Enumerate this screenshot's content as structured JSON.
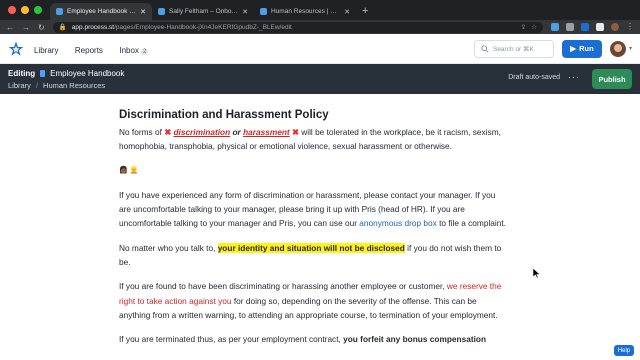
{
  "browser": {
    "tabs": [
      {
        "title": "Employee Handbook | Proces",
        "active": true
      },
      {
        "title": "Sally Feltham – Onboarding | P",
        "active": false
      },
      {
        "title": "Human Resources | Process St",
        "active": false
      }
    ],
    "url_host": "app.process.st",
    "url_path": "/pages/Employee-Handbook-jXn4JeKERfGpudbZ-_BLEw/edit"
  },
  "header": {
    "nav": {
      "library": "Library",
      "reports": "Reports",
      "inbox": "Inbox",
      "inbox_count": "2"
    },
    "search_placeholder": "Search or ⌘K",
    "run_label": "Run"
  },
  "editbar": {
    "editing_label": "Editing",
    "doc_title": "Employee Handbook",
    "breadcrumb": [
      "Library",
      "Human Resources"
    ],
    "autosave": "Draft auto-saved",
    "more": "···",
    "publish_label": "Publish"
  },
  "content": {
    "heading": "Discrimination and Harassment Policy",
    "p1": {
      "pre": "No forms of ",
      "x": "✖",
      "w1": "discrimination",
      "mid": " or ",
      "w2": "harassment",
      "post": " will be tolerated in the workplace, be it racism, sexism, homophobia, transphobia, physical or emotional violence, sexual harassment or otherwise."
    },
    "emoji": "👩🏾 👱",
    "p2": {
      "pre": "If you have experienced any form of discrimination or harassment, please contact your manager. If you are uncomfortable talking to your manager, please bring it up with Pris (head of HR). If you are uncomfortable talking to your manager and Pris, you can use our ",
      "link": "anonymous drop box",
      "post": " to file a complaint."
    },
    "p3": {
      "pre": "No matter who you talk to, ",
      "highlight": "your identity and situation will not be disclosed",
      "post": " if you do not wish them to be."
    },
    "p4": {
      "pre": "If you are found to have been discriminating or harassing another employee or customer, ",
      "red": "we reserve the right to take action against you",
      "post": " for doing so, depending on the severity of the offense. This can be anything from a written warning, to attending an appropriate course, to termination of your employment."
    },
    "p5": {
      "pre": "If you are terminated thus, as per your employment contract, ",
      "bold": "you forfeit any bonus compensation"
    }
  },
  "help_label": "Help",
  "colors": {
    "accent": "#1b6fd3",
    "publish": "#2e8b57",
    "editbar": "#283039",
    "highlight": "#fff11a",
    "danger": "#c62828"
  }
}
